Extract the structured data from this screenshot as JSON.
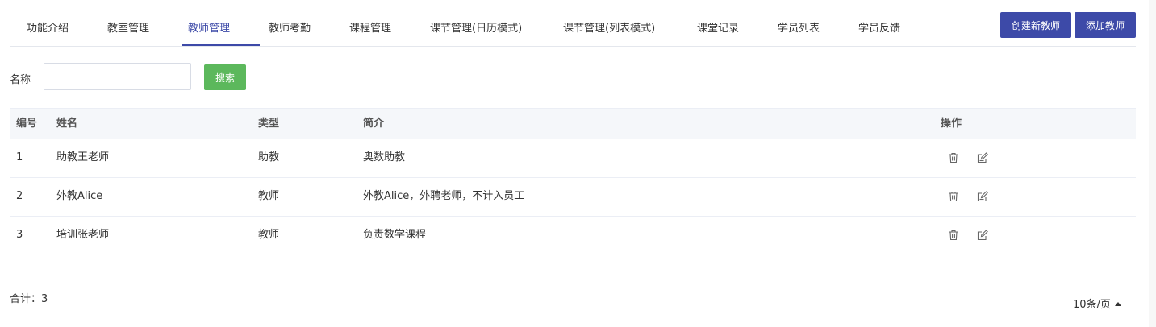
{
  "tabs": [
    {
      "label": "功能介绍"
    },
    {
      "label": "教室管理"
    },
    {
      "label": "教师管理",
      "active": true
    },
    {
      "label": "教师考勤"
    },
    {
      "label": "课程管理"
    },
    {
      "label": "课节管理(日历模式)"
    },
    {
      "label": "课节管理(列表模式)"
    },
    {
      "label": "课堂记录"
    },
    {
      "label": "学员列表"
    },
    {
      "label": "学员反馈"
    }
  ],
  "toolbar": {
    "create_teacher_label": "创建新教师",
    "add_teacher_label": "添加教师"
  },
  "search": {
    "label": "名称",
    "value": "",
    "placeholder": "",
    "button_label": "搜索"
  },
  "table": {
    "headers": {
      "id": "编号",
      "name": "姓名",
      "type": "类型",
      "intro": "简介",
      "actions": "操作"
    },
    "rows": [
      {
        "id": "1",
        "name": "助教王老师",
        "type": "助教",
        "intro": "奥数助教"
      },
      {
        "id": "2",
        "name": "外教Alice",
        "type": "教师",
        "intro": "外教Alice，外聘老师，不计入员工"
      },
      {
        "id": "3",
        "name": "培训张老师",
        "type": "教师",
        "intro": "负责数学课程"
      }
    ],
    "action_icons": [
      "trash-icon",
      "edit-icon"
    ]
  },
  "footer": {
    "total_label": "合计：3",
    "page_size_label": "10条/页"
  },
  "colors": {
    "primary": "#3d4aa8",
    "success": "#5cb85c",
    "header_bg": "#f5f7fa",
    "border": "#ebeef5",
    "icon": "#666666"
  }
}
